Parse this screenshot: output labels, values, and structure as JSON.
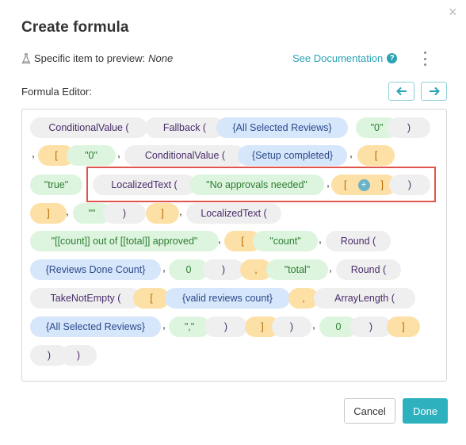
{
  "dialog": {
    "title": "Create formula",
    "close_glyph": "×",
    "preview_label": "Specific item to preview:",
    "preview_value": "None",
    "docs_link": "See Documentation",
    "editor_label": "Formula Editor:",
    "cancel": "Cancel",
    "done": "Done"
  },
  "formula": {
    "row1": [
      "ConditionalValue (",
      "Fallback (",
      "{All Selected Reviews}",
      "\"0\"",
      ")"
    ],
    "row2": [
      ",",
      "[",
      "\"0\"",
      ",",
      "ConditionalValue (",
      "{Setup completed}",
      ",",
      "["
    ],
    "row3": [
      "\"true\"",
      "LocalizedText (",
      "\"No approvals needed\"",
      ",",
      "[",
      "]",
      ")"
    ],
    "row4": [
      "]",
      ",",
      "\"\"",
      ")",
      "]",
      ",",
      "LocalizedText ("
    ],
    "row5": [
      "\"[[count]] out of [[total]] approved\"",
      ",",
      "[",
      "\"count\"",
      ",",
      "Round ("
    ],
    "row6": [
      "{Reviews Done Count}",
      ",",
      "0",
      ")",
      ",",
      "\"total\"",
      ",",
      "Round ("
    ],
    "row7": [
      "TakeNotEmpty (",
      "[",
      "{valid reviews count}",
      ",",
      "ArrayLength ("
    ],
    "row8": [
      "{All Selected Reviews}",
      ",",
      "\",\"",
      ")",
      "]",
      ")",
      ",",
      "0",
      ")",
      "]"
    ],
    "row9": [
      ")",
      ")"
    ]
  },
  "colors": {
    "accent": "#2eb1bf",
    "function_chip": "#efefef",
    "field_chip": "#d6e6fb",
    "string_chip": "#ddf5df",
    "bracket_chip": "#fde0a6",
    "highlight": "#e0554b"
  },
  "icons": {
    "flask": "flask-icon",
    "help": "question-circle-icon",
    "more": "kebab-icon",
    "back": "arrow-left-icon",
    "forward": "arrow-right-icon",
    "add": "plus-circle-icon"
  }
}
